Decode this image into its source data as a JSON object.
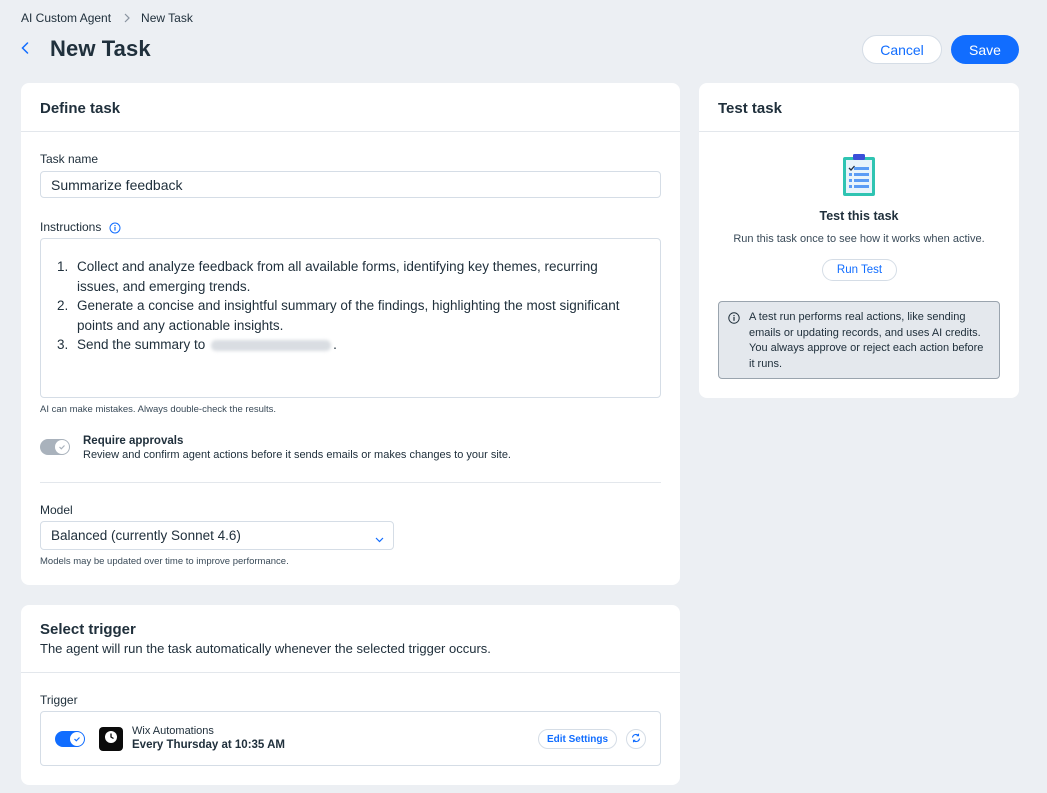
{
  "breadcrumb": {
    "parent": "AI Custom Agent",
    "current": "New Task"
  },
  "header": {
    "title": "New Task",
    "cancel_label": "Cancel",
    "save_label": "Save"
  },
  "define": {
    "title": "Define task",
    "task_name_label": "Task name",
    "task_name_value": "Summarize feedback",
    "instructions_label": "Instructions",
    "instructions": [
      {
        "num": "1.",
        "text": "Collect and analyze feedback from all available forms, identifying key themes, recurring issues, and emerging trends."
      },
      {
        "num": "2.",
        "text": "Generate a concise and insightful summary of the findings, highlighting the most significant points and any actionable insights."
      },
      {
        "num": "3.",
        "text": "Send the summary to",
        "suffix": "."
      }
    ],
    "disclaimer": "AI can make mistakes. Always double-check the results.",
    "approvals_title": "Require approvals",
    "approvals_desc": "Review and confirm agent actions before it sends emails or makes changes to your site.",
    "approvals_enabled": false,
    "model_label": "Model",
    "model_value": "Balanced (currently Sonnet 4.6)",
    "model_hint": "Models may be updated over time to improve performance."
  },
  "trigger": {
    "title": "Select trigger",
    "subtitle": "The agent will run the task automatically whenever the selected trigger occurs.",
    "trigger_label": "Trigger",
    "enabled": true,
    "app_name": "Wix Automations",
    "schedule": "Every Thursday at 10:35 AM",
    "edit_label": "Edit Settings"
  },
  "test": {
    "title": "Test task",
    "heading": "Test this task",
    "desc": "Run this task once to see how it works when active.",
    "run_label": "Run Test",
    "notice": "A test run performs real actions, like sending emails or updating records, and uses AI credits. You always approve or reject each action before it runs."
  },
  "colors": {
    "accent": "#116dff",
    "background": "#eceff3",
    "text": "#20303c"
  },
  "icons": [
    "chevron-right-icon",
    "back-arrow-icon",
    "info-icon",
    "chevron-down-icon",
    "clock-icon",
    "refresh-icon",
    "clipboard-icon",
    "check-icon"
  ]
}
